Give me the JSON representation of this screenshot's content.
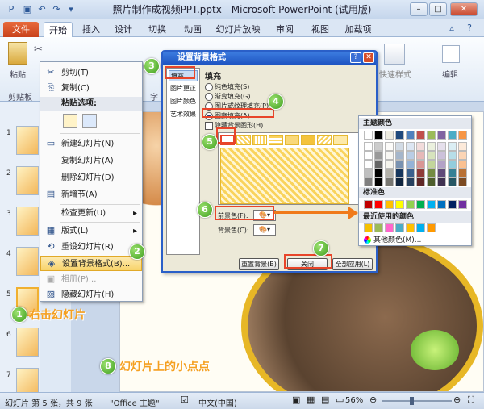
{
  "window": {
    "title": "照片制作成视频PPT.pptx - Microsoft PowerPoint (试用版)"
  },
  "tabs": [
    "文件",
    "开始",
    "插入",
    "设计",
    "切换",
    "动画",
    "幻灯片放映",
    "审阅",
    "视图",
    "加载项"
  ],
  "ribbon": {
    "paste_label": "粘贴",
    "clipboard_label": "剪贴板",
    "quick_style_label": "快速样式",
    "edit_label": "编辑",
    "font_label": "字"
  },
  "slide_numbers": [
    "1",
    "2",
    "3",
    "4",
    "5",
    "6",
    "7"
  ],
  "context_menu": {
    "items": [
      {
        "label": "剪切(T)",
        "icon": "scissors-icon"
      },
      {
        "label": "复制(C)",
        "icon": "copy-icon"
      },
      {
        "label": "粘贴选项:",
        "header": true
      },
      {
        "label": "新建幻灯片(N)"
      },
      {
        "label": "复制幻灯片(A)"
      },
      {
        "label": "删除幻灯片(D)"
      },
      {
        "label": "新增节(A)"
      },
      {
        "label": "检查更新(U)"
      },
      {
        "label": "版式(L)"
      },
      {
        "label": "重设幻灯片(R)"
      },
      {
        "label": "设置背景格式(B)...",
        "highlighted": true
      },
      {
        "label": "相册(P)...",
        "disabled": true
      },
      {
        "label": "隐藏幻灯片(H)"
      }
    ]
  },
  "dialog": {
    "title": "设置背景格式",
    "nav": [
      "填充",
      "图片更正",
      "图片颜色",
      "艺术效果"
    ],
    "section_title": "填充",
    "options": [
      "纯色填充(S)",
      "渐变填充(G)",
      "图片或纹理填充(P)",
      "图案填充(A)"
    ],
    "selected_option": "图案填充(A)",
    "hide_bg_label": "隐藏背景图形(H)",
    "foreground_label": "前景色(F):",
    "background_label": "背景色(C):",
    "reset_button": "重置背景(B)",
    "close_button": "关闭",
    "apply_all_button": "全部应用(L)"
  },
  "palette": {
    "theme_colors_label": "主题颜色",
    "standard_colors_label": "标准色",
    "recent_colors_label": "最近使用的颜色",
    "more_colors_label": "其他颜色(M)...",
    "theme_top": [
      "#ffffff",
      "#000000",
      "#eeece1",
      "#1f497d",
      "#4f81bd",
      "#c0504d",
      "#9bbb59",
      "#8064a2",
      "#4bacc6",
      "#f79646"
    ],
    "standard": [
      "#c00000",
      "#ff0000",
      "#ffc000",
      "#ffff00",
      "#92d050",
      "#00b050",
      "#00b0f0",
      "#0070c0",
      "#002060",
      "#7030a0"
    ],
    "recent": [
      "#f5c100",
      "#9bbb59",
      "#ff66cc",
      "#4bacc6",
      "#ffc000",
      "#00b0f0",
      "#ff9900"
    ]
  },
  "annotations": {
    "steps": [
      "1",
      "2",
      "3",
      "4",
      "5",
      "6",
      "7",
      "8"
    ],
    "step1_text": "右击幻灯片",
    "step8_text": "幻灯片上的小点点"
  },
  "status": {
    "slide_info": "幻灯片 第 5 张，共 9 张",
    "theme": "\"Office 主题\"",
    "language": "中文(中国)",
    "zoom": "56%"
  }
}
